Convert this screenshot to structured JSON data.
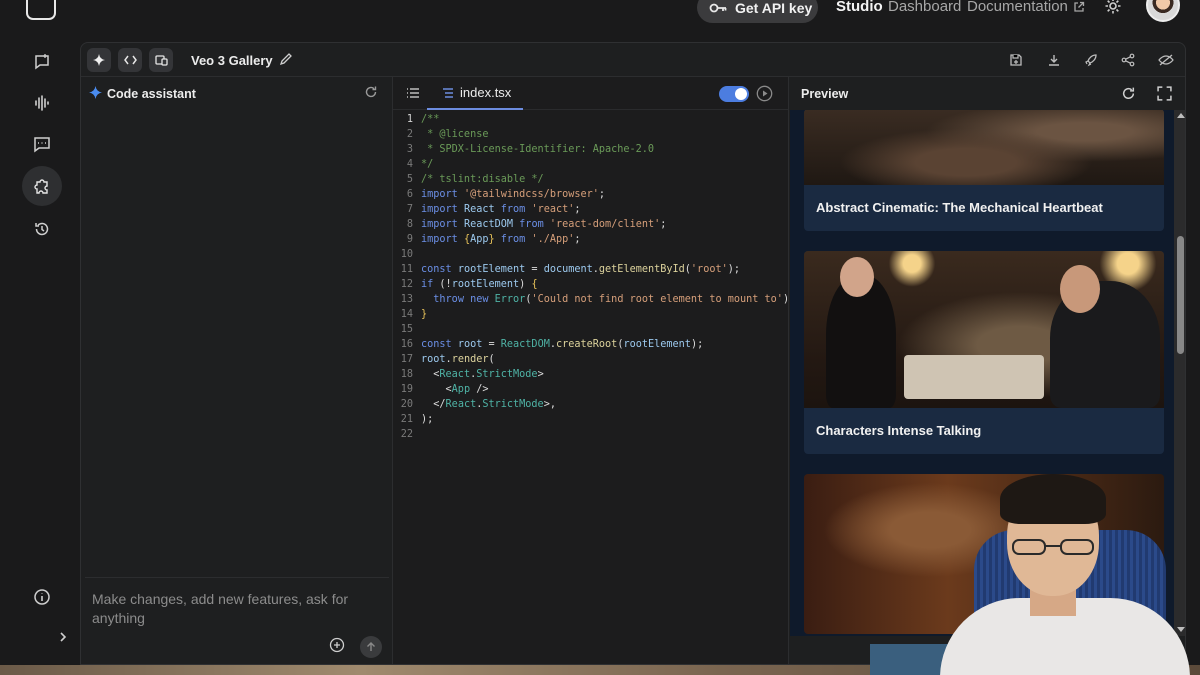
{
  "topbar": {
    "get_api_key": "Get API key",
    "nav_studio": "Studio",
    "nav_dashboard": "Dashboard",
    "nav_documentation": "Documentation"
  },
  "toolbar": {
    "app_title": "Veo 3 Gallery"
  },
  "assistant": {
    "title": "Code assistant",
    "placeholder": "Make changes, add new features, ask for anything"
  },
  "code_panel": {
    "file_tab": "index.tsx",
    "run_toggle_on": true
  },
  "preview": {
    "title": "Preview",
    "cards": [
      {
        "title": "Abstract Cinematic: The Mechanical Heartbeat"
      },
      {
        "title": "Characters Intense Talking"
      },
      {
        "title": ""
      }
    ],
    "scroll_position": 0.3
  },
  "icons": {
    "rail": [
      "chat-icon",
      "audio-waveform-icon",
      "message-icon",
      "build-icon",
      "history-icon",
      "info-icon",
      "chevron-right-icon"
    ],
    "toolbar": [
      "sparkle-icon",
      "code-icon",
      "device-icon",
      "pencil-icon",
      "save-icon",
      "download-icon",
      "deploy-rocket-icon",
      "share-icon",
      "hide-icon"
    ]
  },
  "colors": {
    "accent": "#4c7de0",
    "background": "#1a1a1b",
    "preview_bg": "#0f1a2b"
  }
}
